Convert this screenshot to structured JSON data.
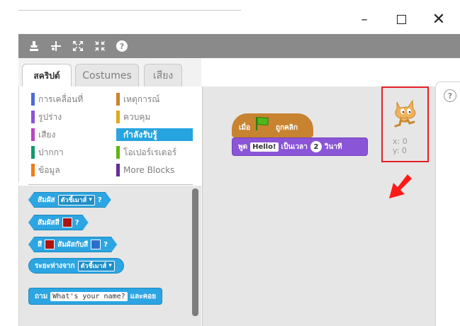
{
  "window": {
    "minimize_glyph": "–",
    "close_glyph": "✕",
    "accent_line": "#c8c8c8"
  },
  "toolbar": {
    "icons": [
      "stamp-icon",
      "cut-icon",
      "grow-icon",
      "shrink-icon",
      "help-icon"
    ],
    "help_glyph": "?"
  },
  "tabs": [
    {
      "label": "สคริปต์",
      "active": true
    },
    {
      "label": "Costumes",
      "active": false
    },
    {
      "label": "เสียง",
      "active": false
    }
  ],
  "categories": {
    "left": [
      {
        "label": "การเคลื่อนที่",
        "color": "#4a6cd4"
      },
      {
        "label": "รูปร่าง",
        "color": "#8a55d7"
      },
      {
        "label": "เสียง",
        "color": "#bb42c3"
      },
      {
        "label": "ปากกา",
        "color": "#0e9a6c"
      },
      {
        "label": "ข้อมูล",
        "color": "#ee7d16"
      }
    ],
    "right": [
      {
        "label": "เหตุการณ์",
        "color": "#c88330"
      },
      {
        "label": "ควบคุม",
        "color": "#e1a91a"
      },
      {
        "label": "กำลังรับรู้",
        "color": "#2ca5e2",
        "selected": true
      },
      {
        "label": "โอเปอร์เรเตอร์",
        "color": "#5cb712"
      },
      {
        "label": "More Blocks",
        "color": "#632d99"
      }
    ]
  },
  "palette_blocks": {
    "touching": {
      "label": "สัมผัส",
      "dropdown": "ตัวชี้เมาส์",
      "q": "?"
    },
    "touching_color": {
      "label": "สัมผัสสี",
      "q": "?",
      "swatch": "#b0130d"
    },
    "color_touching": {
      "pre": "สี",
      "mid": "สัมผัสกับสี",
      "q": "?",
      "swatch1": "#b0130d",
      "swatch2": "#2d6ec8"
    },
    "distance": {
      "label": "ระยะห่างจาก",
      "dropdown": "ตัวชี้เมาส์"
    },
    "ask": {
      "label": "ถาม",
      "text": "What's your name?",
      "suffix": "และคอย"
    }
  },
  "script": {
    "hat": {
      "when": "เมื่อ",
      "suffix": "ถูกคลิก",
      "flag_color": "#4bb81b"
    },
    "say": {
      "label": "พูด",
      "text": "Hello!",
      "mid": "เป็นเวลา",
      "num": "2",
      "suffix": "วินาที"
    }
  },
  "sprite": {
    "x_label": "x:",
    "x_value": "0",
    "y_label": "y:",
    "y_value": "0",
    "highlight_color": "#e4202a"
  },
  "help": {
    "glyph": "?"
  }
}
